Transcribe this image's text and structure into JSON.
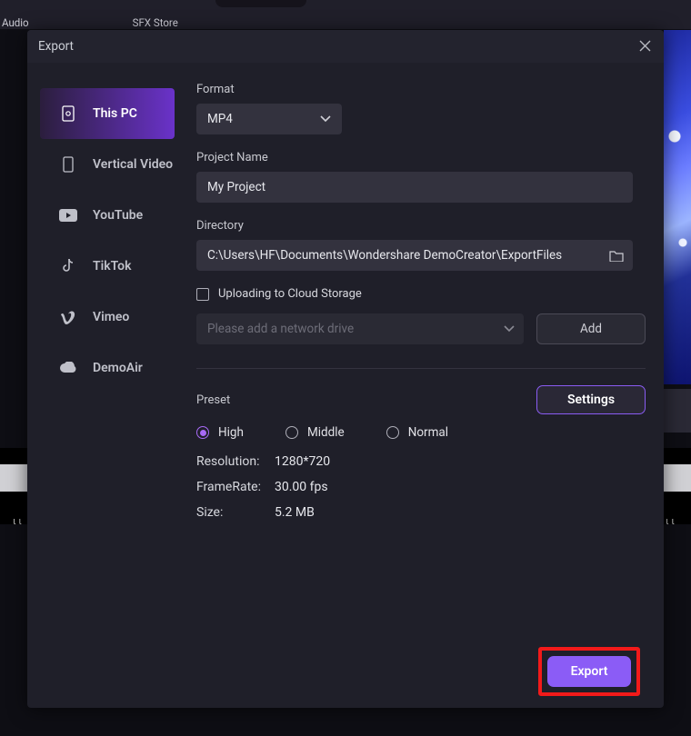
{
  "topbar": {
    "audio_label": "Audio",
    "sfx_label": "SFX Store"
  },
  "dialog": {
    "title": "Export"
  },
  "sidebar": {
    "items": [
      {
        "label": "This PC"
      },
      {
        "label": "Vertical Video"
      },
      {
        "label": "YouTube"
      },
      {
        "label": "TikTok"
      },
      {
        "label": "Vimeo"
      },
      {
        "label": "DemoAir"
      }
    ]
  },
  "form": {
    "format_label": "Format",
    "format_value": "MP4",
    "project_label": "Project Name",
    "project_value": "My Project",
    "directory_label": "Directory",
    "directory_value": "C:\\Users\\HF\\Documents\\Wondershare DemoCreator\\ExportFiles",
    "cloud_label": "Uploading to Cloud Storage",
    "network_placeholder": "Please add a network drive",
    "add_label": "Add",
    "preset_label": "Preset",
    "settings_label": "Settings",
    "radios": {
      "high": "High",
      "middle": "Middle",
      "normal": "Normal"
    },
    "meta": {
      "resolution_k": "Resolution:",
      "resolution_v": "1280*720",
      "framerate_k": "FrameRate:",
      "framerate_v": "30.00 fps",
      "size_k": "Size:",
      "size_v": "5.2 MB"
    }
  },
  "footer": {
    "export_label": "Export"
  }
}
